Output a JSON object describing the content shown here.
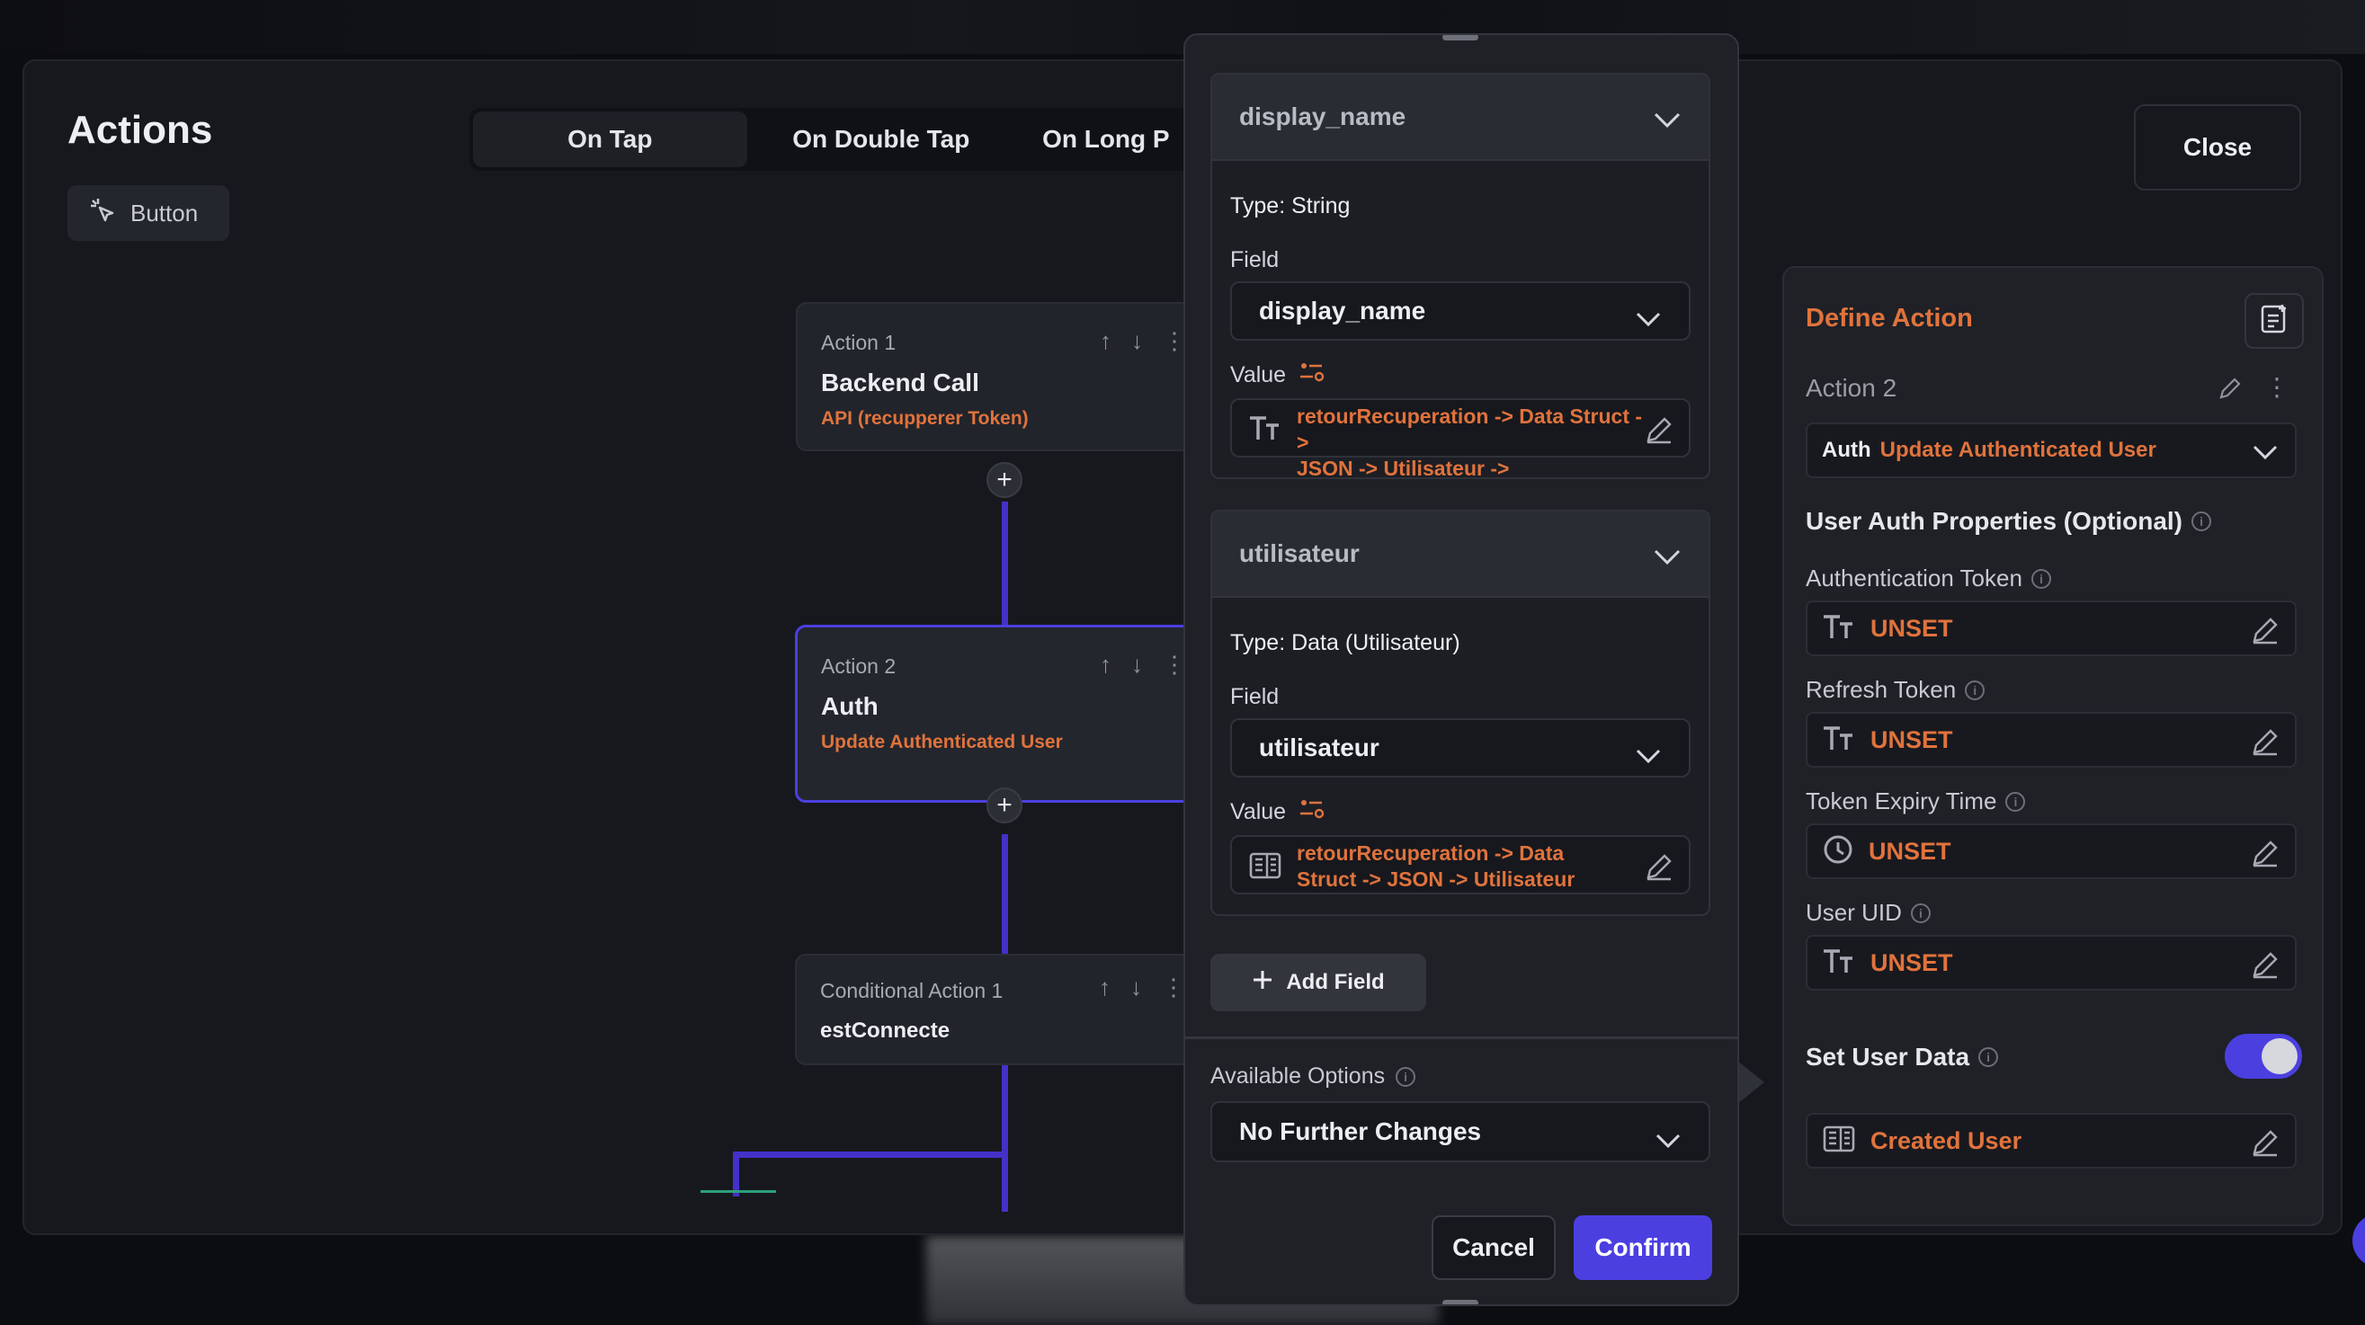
{
  "panel": {
    "title": "Actions",
    "chip_label": "Button",
    "tabs": [
      "On Tap",
      "On Double Tap",
      "On Long P"
    ],
    "close_label": "Close"
  },
  "flow": {
    "nodes": [
      {
        "label": "Action 1",
        "title": "Backend Call",
        "subtitle": "API (recupperer Token)"
      },
      {
        "label": "Action 2",
        "title": "Auth",
        "subtitle": "Update Authenticated User"
      },
      {
        "label": "Conditional Action 1",
        "title": "estConnecte",
        "subtitle": ""
      }
    ]
  },
  "define": {
    "title": "Define Action",
    "action_label": "Action 2",
    "action_prefix": "Auth",
    "action_value": "Update Authenticated User",
    "section_title": "User Auth Properties (Optional)",
    "props": [
      {
        "label": "Authentication Token",
        "value": "UNSET",
        "icon": "text-type-icon"
      },
      {
        "label": "Refresh Token",
        "value": "UNSET",
        "icon": "text-type-icon"
      },
      {
        "label": "Token Expiry Time",
        "value": "UNSET",
        "icon": "clock-icon"
      },
      {
        "label": "User UID",
        "value": "UNSET",
        "icon": "text-type-icon"
      }
    ],
    "set_user_data_label": "Set User Data",
    "set_user_data_on": true,
    "user_data_value": "Created User"
  },
  "modal": {
    "cards": [
      {
        "header": "display_name",
        "type_text": "Type: String",
        "field_label": "Field",
        "field_value": "display_name",
        "value_label": "Value",
        "value_line1": "retourRecuperation -> Data Struct ->",
        "value_line2": "JSON -> Utilisateur ->"
      },
      {
        "header": "utilisateur",
        "type_text": "Type: Data (Utilisateur)",
        "field_label": "Field",
        "field_value": "utilisateur",
        "value_label": "Value",
        "value_line1": "retourRecuperation -> Data",
        "value_line2": "Struct -> JSON -> Utilisateur"
      }
    ],
    "add_field_label": "Add Field",
    "available_options_label": "Available Options",
    "available_options_value": "No Further Changes",
    "cancel_label": "Cancel",
    "confirm_label": "Confirm"
  },
  "colors": {
    "accent": "#4b3fe0",
    "orange": "#e0733d"
  }
}
